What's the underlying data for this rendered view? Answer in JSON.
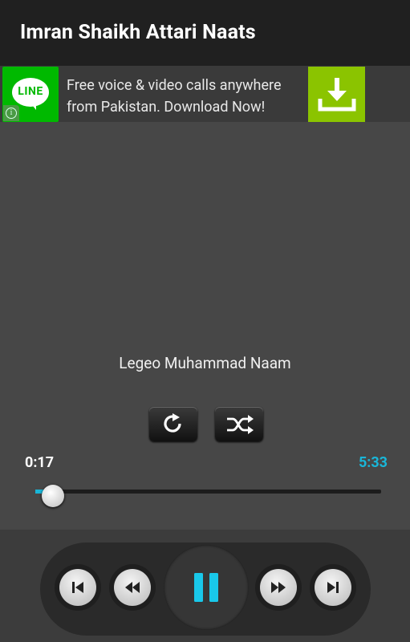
{
  "app": {
    "title": "Imran Shaikh Attari Naats"
  },
  "ad": {
    "logo_text": "LINE",
    "line1": "Free voice & video calls anywhere",
    "line2": "from Pakistan. Download Now!",
    "info_glyph": "i",
    "download_icon": "download-icon"
  },
  "player": {
    "song_title": "Legeo Muhammad Naam",
    "elapsed": "0:17",
    "duration": "5:33",
    "progress": 0.05,
    "accent_color": "#19b6d8",
    "repeat_icon": "repeat-icon",
    "shuffle_icon": "shuffle-icon"
  },
  "controls": {
    "previous": "skip-previous-icon",
    "rewind": "rewind-icon",
    "pause": "pause-icon",
    "fast_forward": "fast-forward-icon",
    "next": "skip-next-icon"
  }
}
